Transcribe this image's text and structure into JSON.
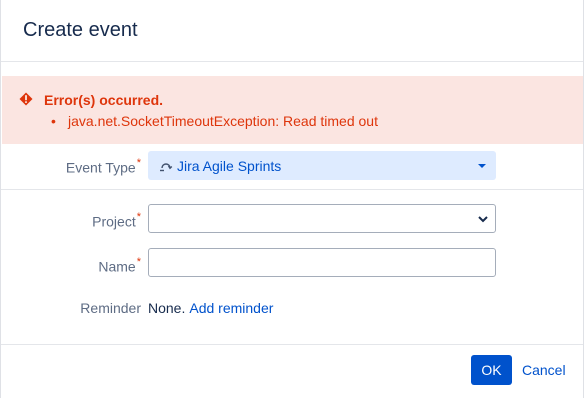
{
  "dialog": {
    "title": "Create event"
  },
  "error": {
    "title": "Error(s) occurred.",
    "items": [
      "java.net.SocketTimeoutException: Read timed out"
    ],
    "color": "#de350b",
    "background": "#fbe5e1"
  },
  "form": {
    "event_type": {
      "label": "Event Type",
      "required": "*",
      "value": "Jira Agile Sprints",
      "icon": "sprint-icon"
    },
    "project": {
      "label": "Project",
      "required": "*",
      "value": ""
    },
    "name": {
      "label": "Name",
      "required": "*",
      "value": ""
    },
    "reminder": {
      "label": "Reminder",
      "value": "None.",
      "link": "Add reminder"
    }
  },
  "footer": {
    "ok_label": "OK",
    "cancel_label": "Cancel"
  },
  "colors": {
    "accent": "#0052cc",
    "selected_bg": "#deebff"
  }
}
